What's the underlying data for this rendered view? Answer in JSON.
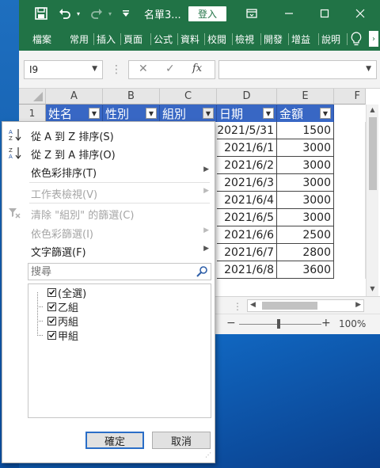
{
  "titlebar": {
    "doc_title": "名單3...",
    "signin_label": "登入",
    "colors": {
      "bar": "#217346"
    }
  },
  "ribbon": {
    "tabs": [
      "檔案",
      "常用",
      "插入",
      "頁面",
      "公式",
      "資料",
      "校閱",
      "檢視",
      "開發",
      "增益",
      "說明"
    ],
    "tab_icons": [
      "lightbulb-icon",
      "chevron-right-icon"
    ]
  },
  "formula_bar": {
    "name_box": "I9",
    "fx_label": "fx",
    "formula_value": ""
  },
  "sheet": {
    "col_headers": [
      "A",
      "B",
      "C",
      "D",
      "E",
      "F"
    ],
    "row_header_first": "1",
    "table_headers": [
      "姓名",
      "性別",
      "組別",
      "日期",
      "金額"
    ],
    "rows": [
      {
        "date": "2021/5/31",
        "amount": "1500"
      },
      {
        "date": "2021/6/1",
        "amount": "3000"
      },
      {
        "date": "2021/6/2",
        "amount": "3000"
      },
      {
        "date": "2021/6/3",
        "amount": "3000"
      },
      {
        "date": "2021/6/4",
        "amount": "3000"
      },
      {
        "date": "2021/6/5",
        "amount": "3000"
      },
      {
        "date": "2021/6/6",
        "amount": "2500"
      },
      {
        "date": "2021/6/7",
        "amount": "2800"
      },
      {
        "date": "2021/6/8",
        "amount": "3600"
      }
    ],
    "header_fill": "#3867c4"
  },
  "status": {
    "zoom_label": "100%",
    "minus": "−",
    "plus": "+"
  },
  "filter_menu": {
    "sort_asc": "從 A 到 Z 排序(S)",
    "sort_desc": "從 Z 到 A 排序(O)",
    "sort_by_color": "依色彩排序(T)",
    "sheet_view": "工作表檢視(V)",
    "clear_filter": "清除 \"組別\" 的篩選(C)",
    "filter_by_color": "依色彩篩選(I)",
    "text_filters": "文字篩選(F)",
    "search_placeholder": "搜尋",
    "items": [
      {
        "label": "(全選)",
        "checked": true
      },
      {
        "label": "乙組",
        "checked": true
      },
      {
        "label": "丙組",
        "checked": true
      },
      {
        "label": "甲組",
        "checked": true
      }
    ],
    "ok_label": "確定",
    "cancel_label": "取消"
  }
}
